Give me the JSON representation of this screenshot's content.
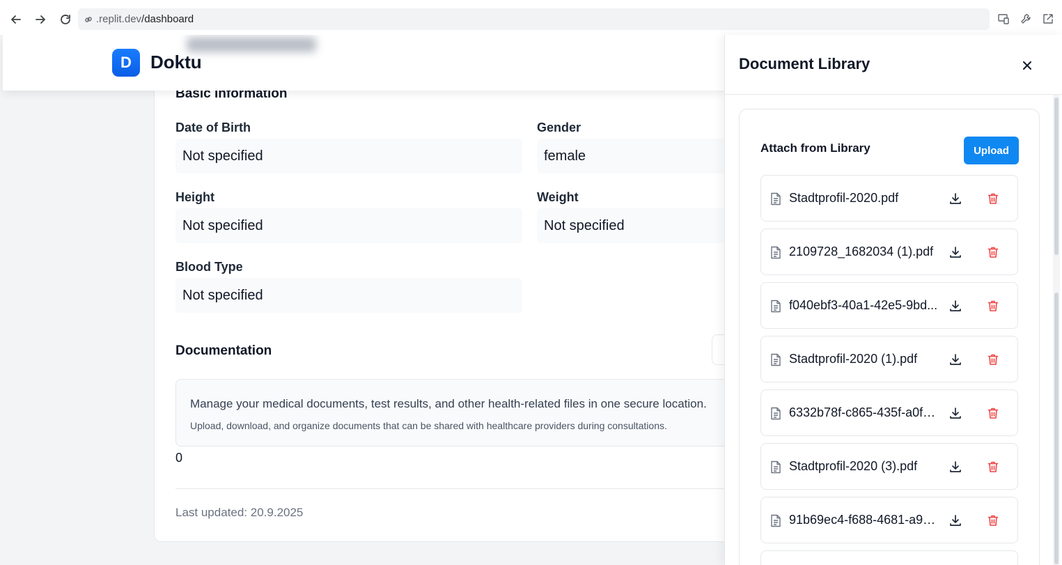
{
  "browser": {
    "url_prefix": ".replit.dev",
    "url_path": "/dashboard"
  },
  "app": {
    "logo_letter": "D",
    "brand": "Doktu"
  },
  "basic_info": {
    "title": "Basic Information",
    "fields": [
      {
        "label": "Date of Birth",
        "value": "Not specified"
      },
      {
        "label": "Gender",
        "value": "female"
      },
      {
        "label": "Height",
        "value": "Not specified"
      },
      {
        "label": "Weight",
        "value": "Not specified"
      },
      {
        "label": "Blood Type",
        "value": "Not specified"
      }
    ]
  },
  "documentation": {
    "title": "Documentation",
    "main_text": "Manage your medical documents, test results, and other health-related files in one secure location.",
    "sub_text": "Upload, download, and organize documents that can be shared with healthcare providers during consultations.",
    "count": "0",
    "last_updated": "Last updated: 20.9.2025"
  },
  "panel": {
    "title": "Document Library",
    "attach_title": "Attach from Library",
    "upload_label": "Upload",
    "documents": [
      "Stadtprofil-2020.pdf",
      "2109728_1682034 (1).pdf",
      "f040ebf3-40a1-42e5-9bd...",
      "Stadtprofil-2020 (1).pdf",
      "6332b78f-c865-435f-a0f0...",
      "Stadtprofil-2020 (3).pdf",
      "91b69ec4-f688-4681-a94..."
    ]
  },
  "colors": {
    "accent": "#1088f2",
    "danger": "#ef4444"
  }
}
